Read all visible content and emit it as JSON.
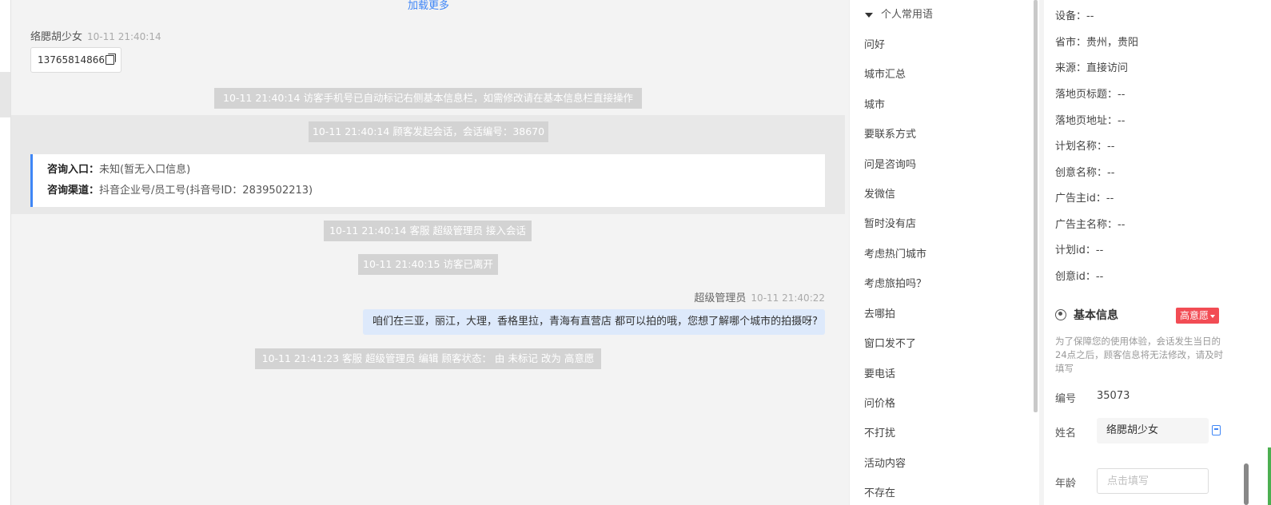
{
  "chat": {
    "load_more": "加载更多",
    "visitor": {
      "name": "络腮胡少女",
      "time": "10-11 21:40:14",
      "phone": "13765814866"
    },
    "system_messages": {
      "phone_marked": "10-11 21:40:14 访客手机号已自动标记右侧基本信息栏，如需修改请在基本信息栏直接操作",
      "session_start": "10-11 21:40:14 顾客发起会话，会话编号：38670",
      "agent_join": "10-11 21:40:14 客服 超级管理员 接入会话",
      "visitor_left": "10-11 21:40:15 访客已离开",
      "status_change": "10-11 21:41:23 客服 超级管理员 编辑 顾客状态： 由 未标记 改为 高意愿"
    },
    "info_card": {
      "entry_label": "咨询入口：",
      "entry_value": "未知(暂无入口信息)",
      "channel_label": "咨询渠道：",
      "channel_value": "抖音企业号/员工号(抖音号ID：2839502213)"
    },
    "agent": {
      "name": "超级管理员",
      "time": "10-11 21:40:22",
      "message": "咱们在三亚，丽江，大理，香格里拉，青海有直营店 都可以拍的哦，您想了解哪个城市的拍摄呀?"
    }
  },
  "phrases": {
    "header": "个人常用语",
    "items": [
      "问好",
      "城市汇总",
      "城市",
      "要联系方式",
      "问是咨询吗",
      "发微信",
      "暂时没有店",
      "考虑热门城市",
      "考虑旅拍吗？",
      "去哪拍",
      "窗口发不了",
      "要电话",
      "问价格",
      "不打扰",
      "活动内容",
      "不存在"
    ]
  },
  "details": {
    "rows": [
      {
        "label": "设备：",
        "value": "--"
      },
      {
        "label": "省市：",
        "value": "贵州，贵阳"
      },
      {
        "label": "来源：",
        "value": "直接访问"
      },
      {
        "label": "落地页标题：",
        "value": "--"
      },
      {
        "label": "落地页地址：",
        "value": "--"
      },
      {
        "label": "计划名称：",
        "value": "--"
      },
      {
        "label": "创意名称：",
        "value": "--"
      },
      {
        "label": "广告主id：",
        "value": "--"
      },
      {
        "label": "广告主名称：",
        "value": "--"
      },
      {
        "label": "计划id：",
        "value": "--"
      },
      {
        "label": "创意id：",
        "value": "--"
      }
    ]
  },
  "basic_info": {
    "title": "基本信息",
    "intent": "高意愿",
    "notice": "为了保障您的使用体验，会话发生当日的24点之后，顾客信息将无法修改，请及时填写",
    "id_label": "编号",
    "id_value": "35073",
    "name_label": "姓名",
    "name_value": "络腮胡少女",
    "age_label": "年龄",
    "age_placeholder": "点击填写"
  },
  "colors": {
    "accent": "#3f86f6",
    "intent_badge": "#f24c54",
    "agent_bubble": "#dde9fb",
    "system_bubble": "#d3d3d3"
  }
}
